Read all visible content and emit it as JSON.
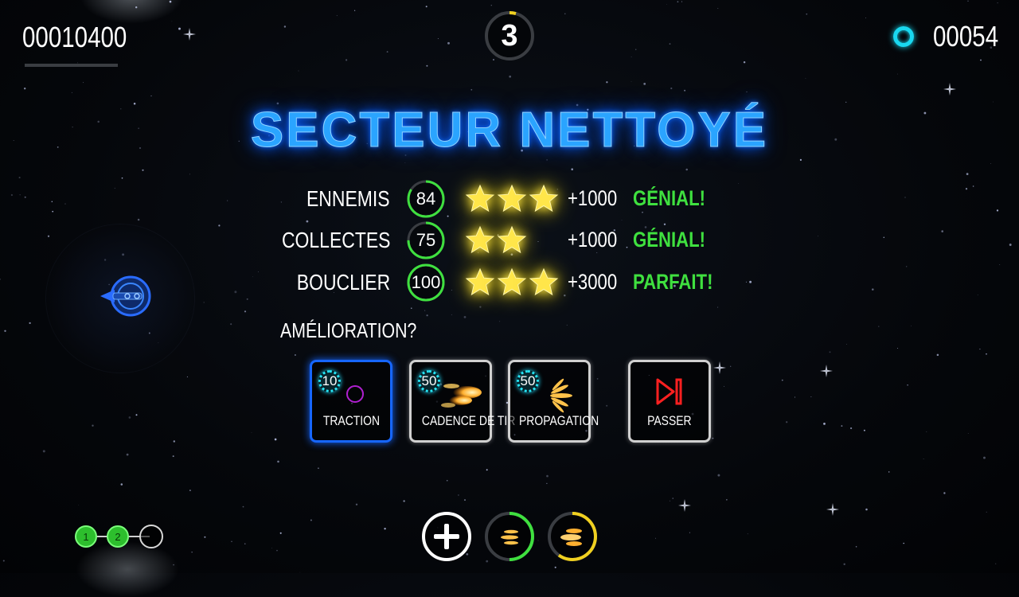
{
  "hud": {
    "score": "00010400",
    "level": "3",
    "coins": "00054",
    "coin_icon": "ring-coin-icon"
  },
  "results": {
    "title": "SECTEUR NETTOYÉ",
    "rows": [
      {
        "label": "ENNEMIS",
        "value": "84",
        "percent": 84,
        "stars": 3,
        "bonus": "+1000",
        "grade": "GÉNIAL!"
      },
      {
        "label": "COLLECTES",
        "value": "75",
        "percent": 75,
        "stars": 2,
        "bonus": "+1000",
        "grade": "GÉNIAL!"
      },
      {
        "label": "BOUCLIER",
        "value": "100",
        "percent": 100,
        "stars": 3,
        "bonus": "+3000",
        "grade": "PARFAIT!"
      }
    ]
  },
  "upgrade": {
    "question": "AMÉLIORATION?",
    "options": [
      {
        "label": "TRACTION",
        "cost": "10",
        "icon": "traction-icon",
        "selected": true
      },
      {
        "label": "CADENCE DE TIR",
        "cost": "50",
        "icon": "fire-rate-icon",
        "selected": false
      },
      {
        "label": "PROPAGATION",
        "cost": "50",
        "icon": "spread-icon",
        "selected": false
      },
      {
        "label": "PASSER",
        "icon": "skip-icon",
        "selected": false
      }
    ]
  },
  "bottom_bar": {
    "add_icon": "plus-icon",
    "weapon1_icon": "bullets-icon",
    "weapon1_level": 0.5,
    "weapon2_icon": "flame-bullets-icon",
    "weapon2_level": 0.6
  },
  "progress": {
    "nodes": [
      "1",
      "2",
      ""
    ]
  },
  "colors": {
    "title_blue": "#2aa4ff",
    "grade_green": "#3fe03f",
    "coin_cyan": "#19d8f0",
    "selected_border": "#1666ff",
    "star_yellow": "#ffe64a"
  }
}
